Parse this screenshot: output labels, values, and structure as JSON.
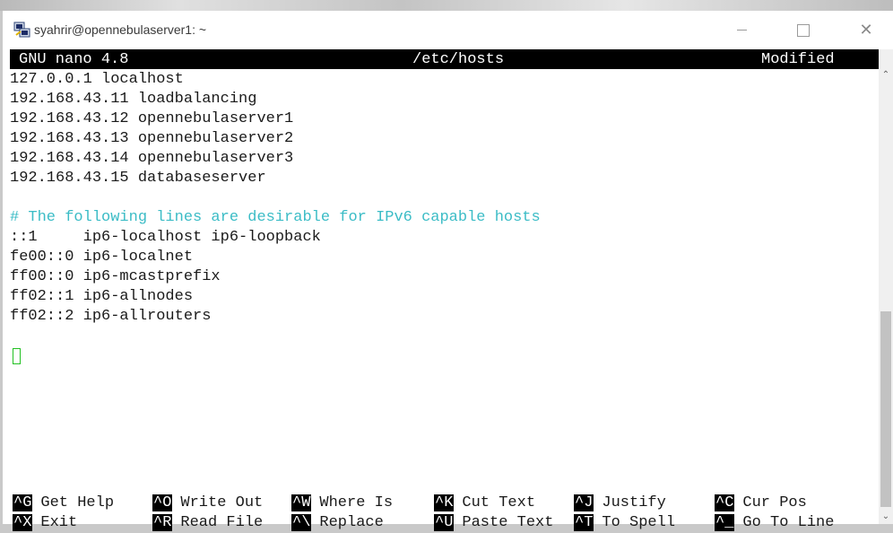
{
  "window": {
    "title": "syahrir@opennebulaserver1: ~",
    "icon": "putty-terminal-icon",
    "controls": {
      "minimize": "minimize-icon",
      "maximize": "maximize-icon",
      "close": "close-icon",
      "close_glyph": "✕"
    }
  },
  "nano": {
    "version": "GNU nano 4.8",
    "filename": "/etc/hosts",
    "status": "Modified"
  },
  "file_lines": [
    {
      "text": "127.0.0.1 localhost",
      "kind": "text"
    },
    {
      "text": "192.168.43.11 loadbalancing",
      "kind": "text"
    },
    {
      "text": "192.168.43.12 opennebulaserver1",
      "kind": "text"
    },
    {
      "text": "192.168.43.13 opennebulaserver2",
      "kind": "text"
    },
    {
      "text": "192.168.43.14 opennebulaserver3",
      "kind": "text"
    },
    {
      "text": "192.168.43.15 databaseserver",
      "kind": "text"
    },
    {
      "text": "",
      "kind": "text"
    },
    {
      "text": "# The following lines are desirable for IPv6 capable hosts",
      "kind": "comment"
    },
    {
      "text": "::1     ip6-localhost ip6-loopback",
      "kind": "text"
    },
    {
      "text": "fe00::0 ip6-localnet",
      "kind": "text"
    },
    {
      "text": "ff00::0 ip6-mcastprefix",
      "kind": "text"
    },
    {
      "text": "ff02::1 ip6-allnodes",
      "kind": "text"
    },
    {
      "text": "ff02::2 ip6-allrouters",
      "kind": "text"
    }
  ],
  "shortcuts": {
    "row1": [
      {
        "key": "^G",
        "label": "Get Help"
      },
      {
        "key": "^O",
        "label": "Write Out"
      },
      {
        "key": "^W",
        "label": "Where Is"
      },
      {
        "key": "^K",
        "label": "Cut Text"
      },
      {
        "key": "^J",
        "label": "Justify"
      },
      {
        "key": "^C",
        "label": "Cur Pos"
      }
    ],
    "row2": [
      {
        "key": "^X",
        "label": "Exit"
      },
      {
        "key": "^R",
        "label": "Read File"
      },
      {
        "key": "^\\",
        "label": "Replace"
      },
      {
        "key": "^U",
        "label": "Paste Text"
      },
      {
        "key": "^T",
        "label": "To Spell"
      },
      {
        "key": "^_",
        "label": "Go To Line"
      }
    ]
  },
  "scrollbar": {
    "up_glyph": "⌃",
    "down_glyph": "⌄"
  }
}
